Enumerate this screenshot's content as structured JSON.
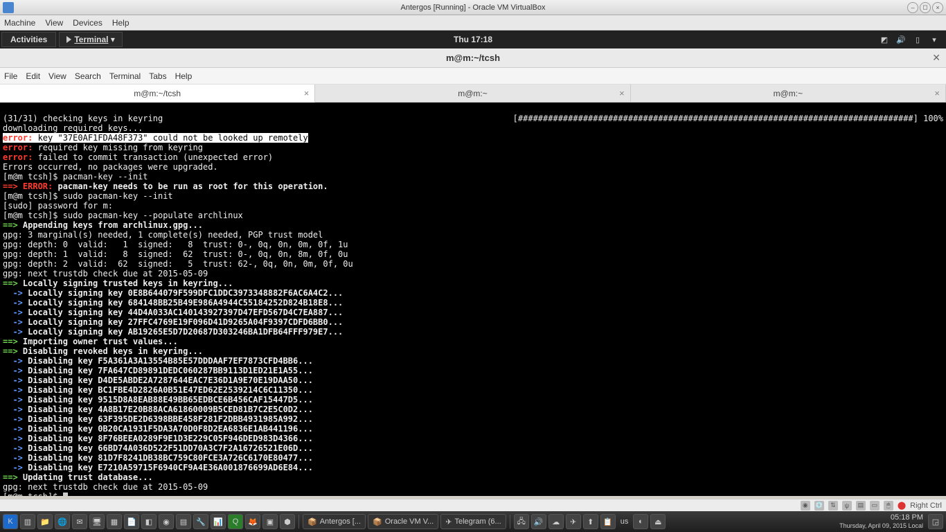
{
  "host": {
    "title": "Antergos [Running] - Oracle VM VirtualBox",
    "menus": [
      "Machine",
      "View",
      "Devices",
      "Help"
    ],
    "status_right": "Right Ctrl",
    "taskbar_tasks": [
      {
        "label": "Antergos [..."
      },
      {
        "label": "Oracle VM V..."
      },
      {
        "label": "Telegram (6..."
      }
    ],
    "clock_time": "05:18 PM",
    "clock_date": "Thursday, April 09, 2015 Local",
    "lang": "us"
  },
  "gnome": {
    "activities": "Activities",
    "app_label": "Terminal",
    "clock": "Thu 17:18"
  },
  "term": {
    "window_title": "m@m:~/tcsh",
    "menus": [
      "File",
      "Edit",
      "View",
      "Search",
      "Terminal",
      "Tabs",
      "Help"
    ],
    "tabs": [
      {
        "label": "m@m:~/tcsh",
        "active": true
      },
      {
        "label": "m@m:~",
        "active": false
      },
      {
        "label": "m@m:~",
        "active": false
      }
    ]
  },
  "lines": {
    "l00a": "(31/31) checking keys in keyring",
    "l00b": " [###############################################################################] 100%",
    "l01": "downloading required keys...",
    "l02a": "error: ",
    "l02b": "key \"37E0AF1FDA48F373\" could not be looked up remotely",
    "l03a": "error:",
    "l03b": " required key missing from keyring",
    "l04a": "error:",
    "l04b": " failed to commit transaction (unexpected error)",
    "l05": "Errors occurred, no packages were upgraded.",
    "l06": "[m@m tcsh]$ pacman-key --init",
    "l07a": "==> ERROR:",
    "l07b": " pacman-key needs to be run as root for this operation.",
    "l08": "[m@m tcsh]$ sudo pacman-key --init",
    "l09": "[sudo] password for m:",
    "l10": "[m@m tcsh]$ sudo pacman-key --populate archlinux",
    "l11a": "==>",
    "l11b": " Appending keys from archlinux.gpg...",
    "l12": "gpg: 3 marginal(s) needed, 1 complete(s) needed, PGP trust model",
    "l13": "gpg: depth: 0  valid:   1  signed:   8  trust: 0-, 0q, 0n, 0m, 0f, 1u",
    "l14": "gpg: depth: 1  valid:   8  signed:  62  trust: 0-, 0q, 0n, 8m, 0f, 0u",
    "l15": "gpg: depth: 2  valid:  62  signed:   5  trust: 62-, 0q, 0n, 0m, 0f, 0u",
    "l16": "gpg: next trustdb check due at 2015-05-09",
    "l17a": "==>",
    "l17b": " Locally signing trusted keys in keyring...",
    "l18a": "  ->",
    "l18b": " Locally signing key 0E8B644079F599DFC1DDC3973348882F6AC6A4C2...",
    "l19b": " Locally signing key 684148BB25B49E986A4944C55184252D824B18E8...",
    "l20b": " Locally signing key 44D4A033AC140143927397D47EFD567D4C7EA887...",
    "l21b": " Locally signing key 27FFC4769E19F096D41D9265A04F9397CDFD6BB0...",
    "l22b": " Locally signing key AB19265E5D7D20687D303246BA1DFB64FFF979E7...",
    "l23a": "==>",
    "l23b": " Importing owner trust values...",
    "l24a": "==>",
    "l24b": " Disabling revoked keys in keyring...",
    "l25b": " Disabling key F5A361A3A13554B85E57DDDAAF7EF7873CFD4BB6...",
    "l26b": " Disabling key 7FA647CD89891DEDC060287BB9113D1ED21E1A55...",
    "l27b": " Disabling key D4DE5ABDE2A7287644EAC7E36D1A9E70E19DAA50...",
    "l28b": " Disabling key BC1FBE4D2826A0B51E47ED62E2539214C6C11350...",
    "l29b": " Disabling key 9515D8A8EAB88E49BB65EDBCE6B456CAF15447D5...",
    "l30b": " Disabling key 4A8B17E20B88ACA61860009B5CED81B7C2E5C0D2...",
    "l31b": " Disabling key 63F395DE2D6398BBE458F281F2DBB4931985A992...",
    "l32b": " Disabling key 0B20CA1931F5DA3A70D0F8D2EA6836E1AB441196...",
    "l33b": " Disabling key 8F76BEEA0289F9E1D3E229C05F946DED983D4366...",
    "l34b": " Disabling key 66BD74A036D522F51DD70A3C7F2A16726521E06D...",
    "l35b": " Disabling key 81D7F8241DB38BC759C80FCE3A726C6170E80477...",
    "l36b": " Disabling key E7210A59715F6940CF9A4E36A001876699AD6E84...",
    "l37a": "==>",
    "l37b": " Updating trust database...",
    "l38": "gpg: next trustdb check due at 2015-05-09",
    "l39": "[m@m tcsh]$ "
  }
}
